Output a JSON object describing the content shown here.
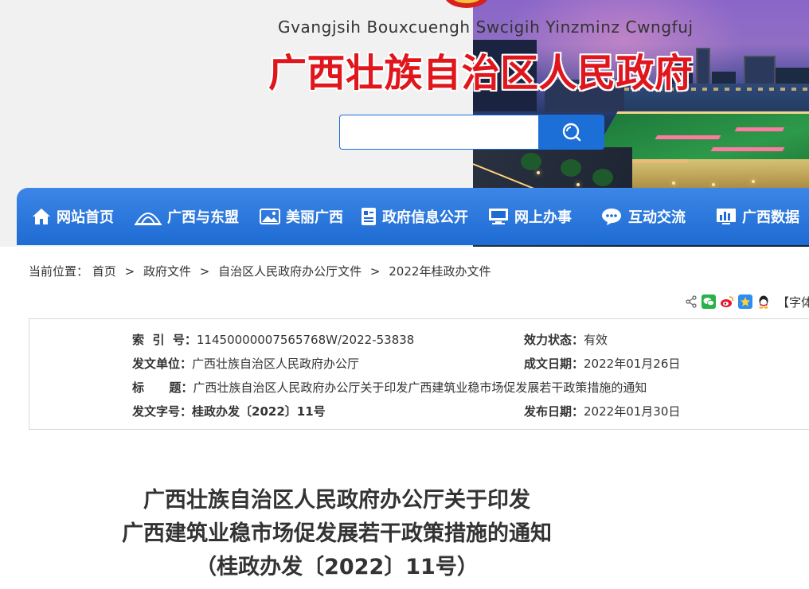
{
  "header": {
    "zhuang_title": "Gvangjsih Bouxcuengh Swcigih Yinzminz Cwngfuj",
    "site_title": "广西壮族自治区人民政府",
    "search": {
      "value": "",
      "placeholder": ""
    }
  },
  "nav": {
    "items": [
      {
        "label": "网站首页",
        "icon": "home-icon"
      },
      {
        "label": "广西与东盟",
        "icon": "landmark-icon"
      },
      {
        "label": "美丽广西",
        "icon": "picture-icon"
      },
      {
        "label": "政府信息公开",
        "icon": "document-list-icon"
      },
      {
        "label": "网上办事",
        "icon": "monitor-icon"
      },
      {
        "label": "互动交流",
        "icon": "chat-bubble-icon"
      },
      {
        "label": "广西数据",
        "icon": "bar-chart-icon"
      }
    ],
    "color": "#1e6bd3"
  },
  "breadcrumb": {
    "prefix": "当前位置：",
    "items": [
      "首页",
      "政府文件",
      "自治区人民政府办公厅文件",
      "2022年桂政办文件"
    ],
    "separator": ">"
  },
  "share": {
    "icons": [
      "share-icon",
      "wechat-icon",
      "weibo-icon",
      "qzone-icon",
      "qq-icon"
    ],
    "font_size_label": "【字体"
  },
  "info": {
    "index_label": "索  引  号：",
    "index_value": "11450000007565768W/2022-53838",
    "status_label": "效力状态：",
    "status_value": "有效",
    "issuer_label": "发文单位：",
    "issuer_value": "广西壮族自治区人民政府办公厅",
    "created_label": "成文日期：",
    "created_value": "2022年01月26日",
    "title_label": "标      题：",
    "title_value": "广西壮族自治区人民政府办公厅关于印发广西建筑业稳市场促发展若干政策措施的通知",
    "docno_label": "发文字号：",
    "docno_value": "桂政办发〔2022〕11号",
    "published_label": "发布日期：",
    "published_value": "2022年01月30日"
  },
  "document": {
    "title_line1": "广西壮族自治区人民政府办公厅关于印发",
    "title_line2": "广西建筑业稳市场促发展若干政策措施的通知",
    "title_line3": "（桂政办发〔2022〕11号）"
  },
  "colors": {
    "brand_red": "#e0161d",
    "brand_blue": "#1d6fd8"
  }
}
